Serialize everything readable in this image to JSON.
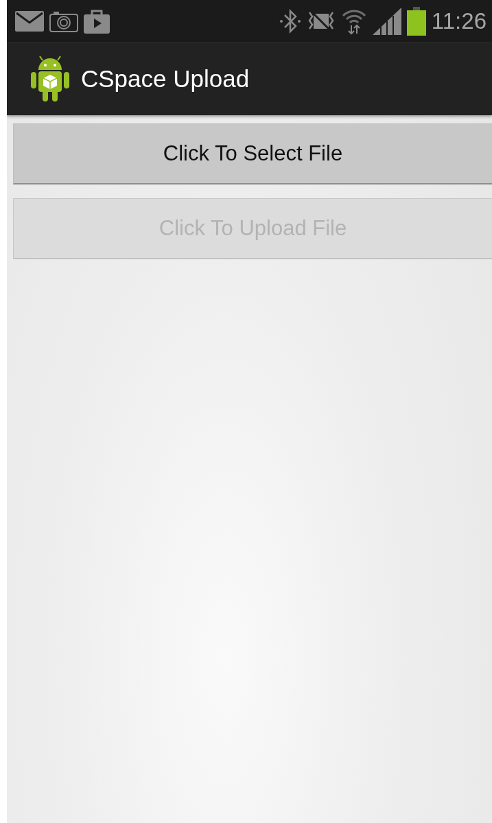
{
  "status_bar": {
    "time": "11:26"
  },
  "action_bar": {
    "title": "CSpace Upload"
  },
  "buttons": [
    {
      "label": "Click To Select File",
      "disabled": false
    },
    {
      "label": "Click To Upload File",
      "disabled": true
    }
  ]
}
